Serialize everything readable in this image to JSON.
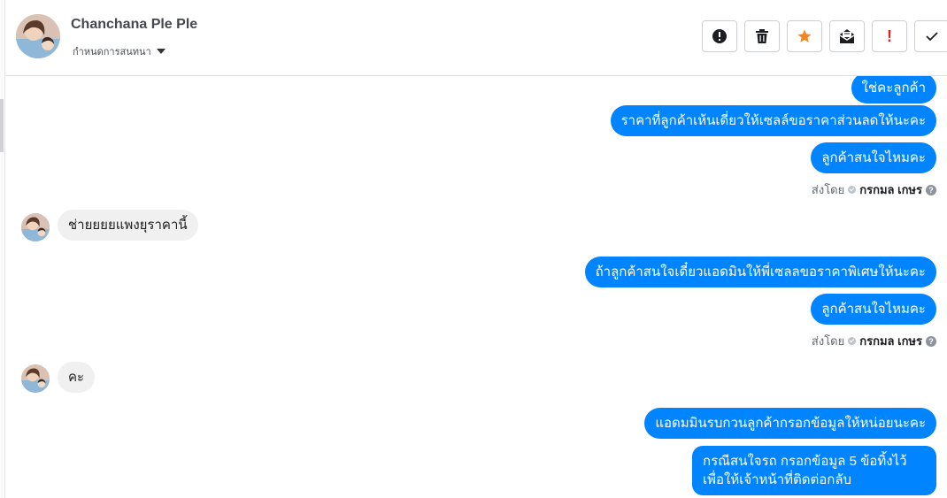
{
  "header": {
    "contact_name": "Chanchana Ple Ple",
    "conversation_settings": "กำหนดการสนทนา"
  },
  "toolbar": {
    "buttons": [
      {
        "name": "mark-spam",
        "icon": "exclamation-circle-icon"
      },
      {
        "name": "delete",
        "icon": "trash-icon"
      },
      {
        "name": "star",
        "icon": "star-icon",
        "color": "#f5861f"
      },
      {
        "name": "mark-unread",
        "icon": "open-envelope-icon"
      },
      {
        "name": "flag-important",
        "icon": "exclamation-icon",
        "color": "#e02020"
      },
      {
        "name": "mark-done",
        "icon": "check-icon"
      }
    ]
  },
  "messages": {
    "out_1": "ใช่คะลูกค้า",
    "out_2": "ราคาที่ลูกค้าเห้นเดี่ยวให้เซลล์ขอราคาส่วนลดให้นะคะ",
    "out_3": "ลูกค้าสนใจไหมคะ",
    "in_1": "ช่ายยยยแพงยุราคานี้",
    "out_4": "ถ้าลูกค้าสนใจเดี๋ยวแอดมินให้พี่เซลลขอราคาพิเศษให้นะคะ",
    "out_5": "ลูกค้าสนใจไหมคะ",
    "in_2": "คะ",
    "out_6": "แอดมมินรบกวนลูกค้ากรอกข้อมูลให้หน่อยนะคะ",
    "out_7_line1": "กรณีสนใจรถ กรอกข้อมูล 5 ข้อทิ้งไว้",
    "out_7_line2": "เพื่อให้เจ้าหน้าที่ติดต่อกลับ"
  },
  "sent_by": {
    "prefix": "ส่งโดย",
    "agent": "กรกมล เกษร"
  },
  "colors": {
    "outgoing_bubble": "#0084ff",
    "incoming_bubble": "#f1f0f0",
    "star": "#f5861f",
    "flag": "#e02020"
  }
}
